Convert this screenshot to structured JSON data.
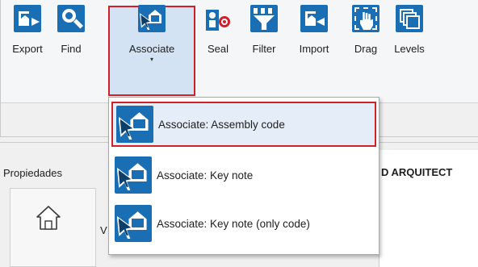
{
  "toolbar": {
    "items": [
      {
        "label": "Export",
        "icon": "export-icon"
      },
      {
        "label": "Find",
        "icon": "find-icon"
      },
      {
        "label": "Associate",
        "icon": "associate-icon",
        "has_dropdown": true,
        "caret": "▾"
      },
      {
        "label": "Seal",
        "icon": "seal-icon"
      },
      {
        "label": "Filter",
        "icon": "filter-icon"
      },
      {
        "label": "Import",
        "icon": "import-icon"
      },
      {
        "label": "Drag",
        "icon": "drag-icon"
      },
      {
        "label": "Levels",
        "icon": "levels-icon"
      }
    ]
  },
  "associate_menu": {
    "items": [
      {
        "label": "Associate: Assembly code",
        "icon": "associate-icon",
        "highlighted": true
      },
      {
        "label": "Associate: Key note",
        "icon": "associate-icon"
      },
      {
        "label": "Associate: Key note (only code)",
        "icon": "associate-icon"
      }
    ]
  },
  "properties": {
    "title": "Propiedades",
    "type_icon": "house-icon",
    "truncated_text": "V"
  },
  "view_panel": {
    "title": "D ARQUITECT"
  },
  "colors": {
    "icon_blue": "#1a6fb4",
    "highlight_red": "#d0202a",
    "active_button_bg": "#d3e3f3"
  }
}
